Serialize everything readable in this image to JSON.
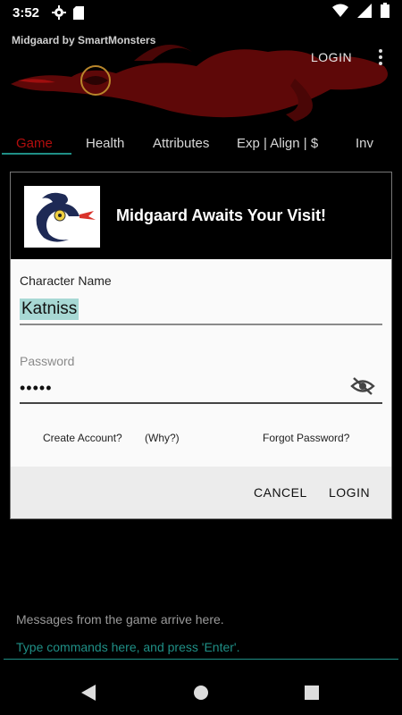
{
  "status_bar": {
    "time": "3:52",
    "icons": [
      "gear-icon",
      "sd-card-icon",
      "wifi-icon",
      "signal-icon",
      "battery-icon"
    ]
  },
  "app_bar": {
    "title": "Midgaard by SmartMonsters",
    "login_label": "LOGIN",
    "menu_icon": "overflow-menu-icon"
  },
  "tabs": [
    {
      "label": "Game",
      "active": true
    },
    {
      "label": "Health",
      "active": false
    },
    {
      "label": "Attributes",
      "active": false
    },
    {
      "label": "Exp | Align | $",
      "active": false
    },
    {
      "label": "Inv",
      "active": false
    }
  ],
  "dialog": {
    "logo_icon": "dragon-logo-icon",
    "title": "Midgaard Awaits Your Visit!",
    "character_name_label": "Character Name",
    "character_name_value": "Katniss",
    "password_label": "Password",
    "password_value": "•••••",
    "visibility_icon": "visibility-off-icon",
    "create_account_label": "Create Account?",
    "why_label": "(Why?)",
    "forgot_password_label": "Forgot Password?",
    "cancel_label": "CANCEL",
    "login_label": "LOGIN"
  },
  "game": {
    "messages_text": "Messages from the game arrive here.",
    "command_placeholder": "Type commands here, and press 'Enter'."
  },
  "nav_bar": {
    "icons": [
      "back-icon",
      "home-icon",
      "recents-icon"
    ]
  },
  "colors": {
    "accent": "#1f8f86",
    "active_tab": "#b30d0d",
    "banner_dragon": "#7a0a0a",
    "highlight": "#a7d8d4"
  }
}
